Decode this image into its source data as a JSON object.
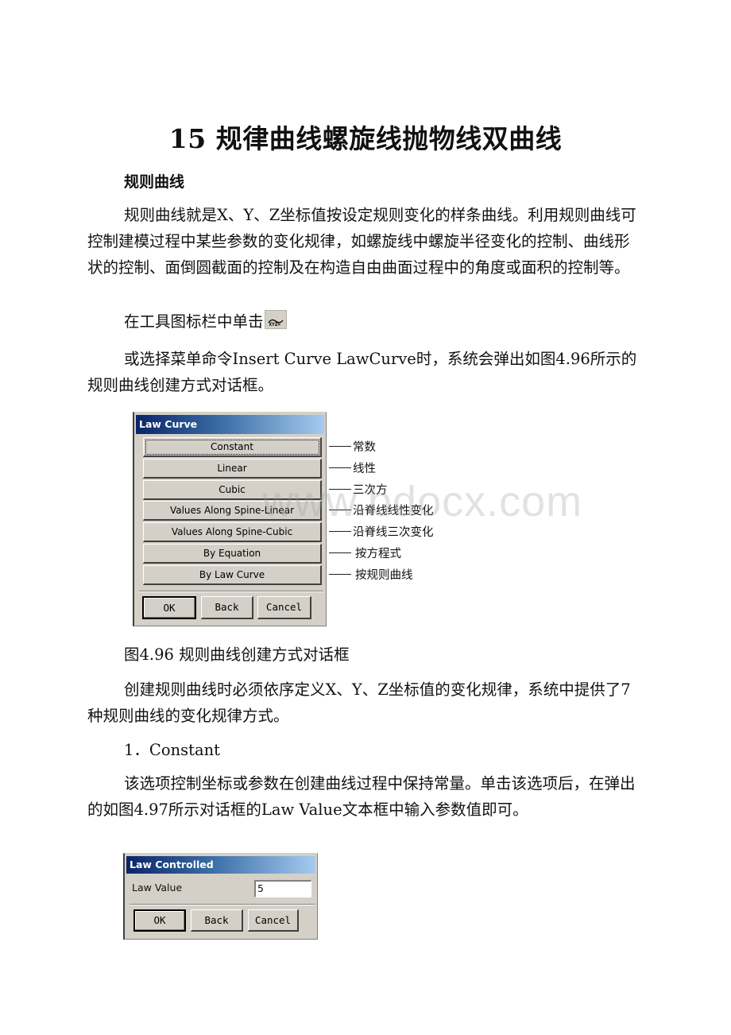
{
  "document": {
    "title": "15 规律曲线螺旋线抛物线双曲线",
    "section_heading": "规则曲线",
    "paragraphs": {
      "intro": "规则曲线就是X、Y、Z坐标值按设定规则变化的样条曲线。利用规则曲线可控制建模过程中某些参数的变化规律，如螺旋线中螺旋半径变化的控制、曲线形状的控制、面倒圆截面的控制及在构造自由曲面过程中的角度或面积的控制等。",
      "toolbar_click": "在工具图标栏中单击",
      "menu_command": "或选择菜单命令Insert Curve LawCurve时，系统会弹出如图4.96所示的规则曲线创建方式对话框。",
      "figure_caption": "图4.96 规则曲线创建方式对话框",
      "seven_ways": "创建规则曲线时必须依序定义X、Y、Z坐标值的变化规律，系统中提供了7种规则曲线的变化规律方式。",
      "item1_heading": "1．Constant",
      "item1_body": "该选项控制坐标或参数在创建曲线过程中保持常量。单击该选项后，在弹出的如图4.97所示对话框的Law Value文本框中输入参数值即可。"
    },
    "toolbar_icon": {
      "name": "law-curve-icon",
      "label": "XYZ="
    },
    "watermark": "www.bdocx.com"
  },
  "law_curve_dialog": {
    "title": "Law Curve",
    "options": [
      {
        "label": "Constant",
        "annotation": "常数"
      },
      {
        "label": "Linear",
        "annotation": "线性"
      },
      {
        "label": "Cubic",
        "annotation": "三次方"
      },
      {
        "label": "Values Along Spine-Linear",
        "annotation": "沿脊线线性变化"
      },
      {
        "label": "Values Along Spine-Cubic",
        "annotation": "沿脊线三次变化"
      },
      {
        "label": "By Equation",
        "annotation": "按方程式"
      },
      {
        "label": "By Law Curve",
        "annotation": "按规则曲线"
      }
    ],
    "buttons": {
      "ok": "OK",
      "back": "Back",
      "cancel": "Cancel"
    }
  },
  "law_controlled_dialog": {
    "title": "Law Controlled",
    "field_label": "Law Value",
    "field_value": "5",
    "buttons": {
      "ok": "OK",
      "back": "Back",
      "cancel": "Cancel"
    }
  }
}
